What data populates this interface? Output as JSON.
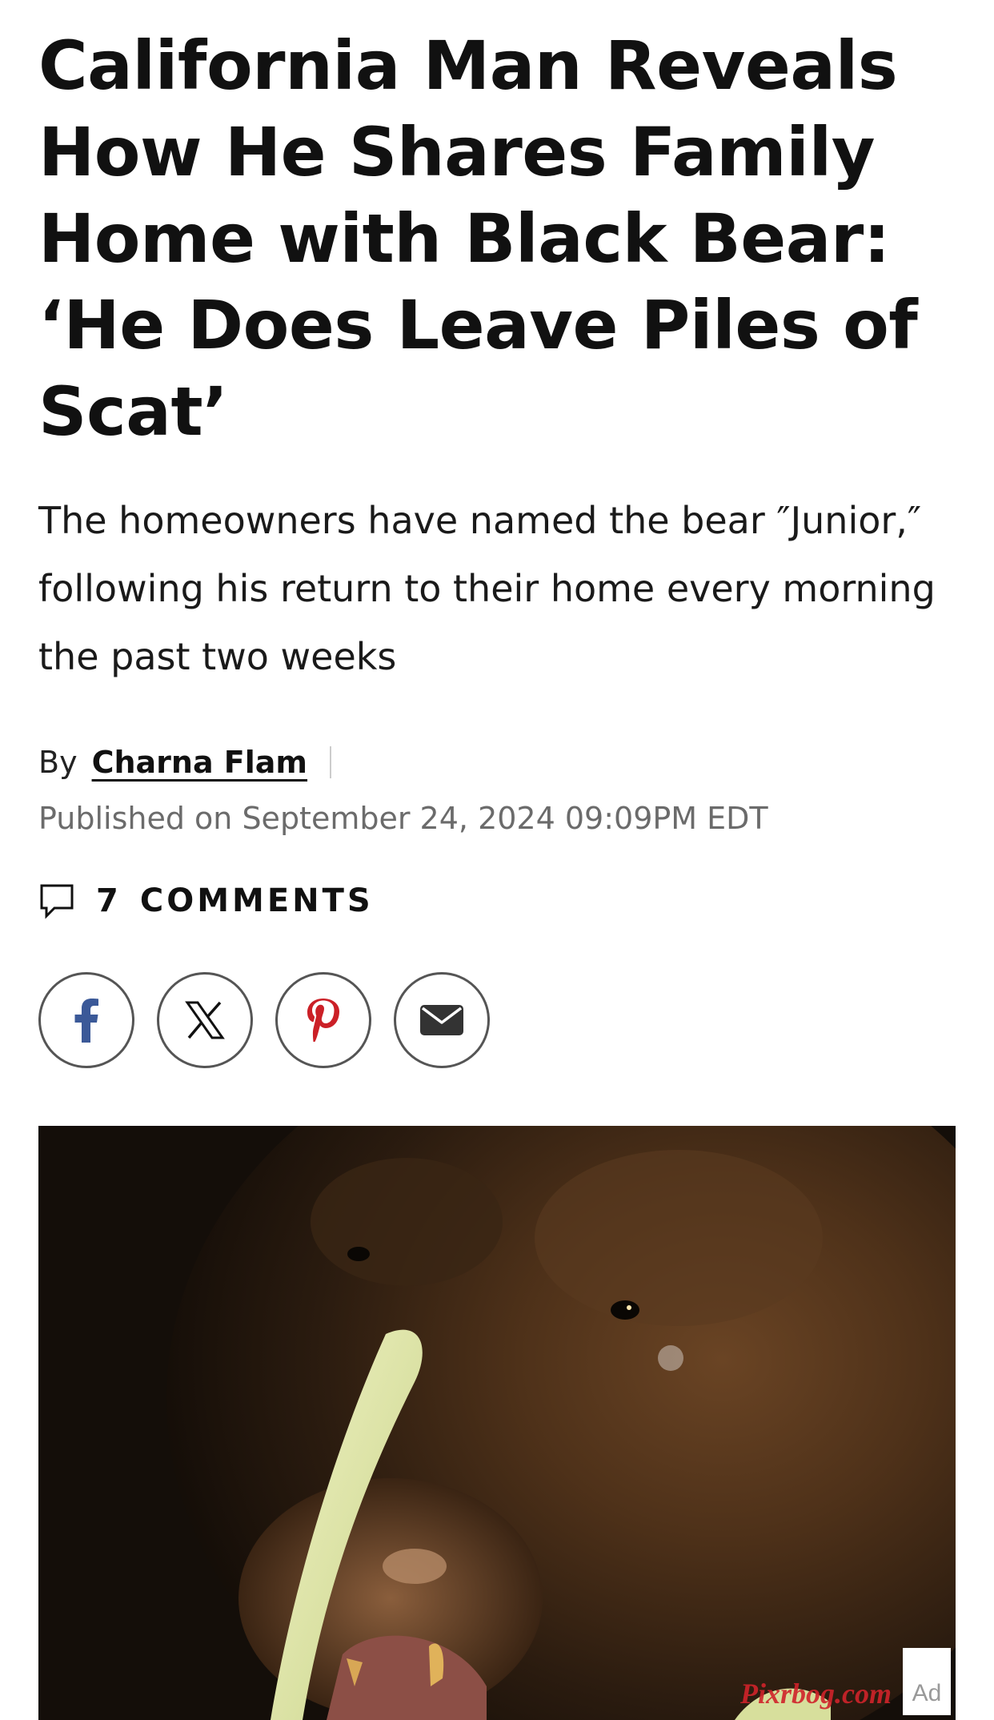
{
  "article": {
    "headline": "California Man Reveals How He Shares Family Home with Black Bear: ‘He Does Leave Piles of Scat’",
    "dek": "The homeowners have named the bear ″Junior,″ following his return to their home every morning the past two weeks",
    "byline_prefix": "By",
    "author": "Charna Flam",
    "published": "Published on September 24, 2024 09:09PM EDT",
    "comments_count": "7",
    "comments_label": "COMMENTS"
  },
  "share_buttons": [
    {
      "name": "facebook",
      "icon": "facebook-icon",
      "color": "#3b5998"
    },
    {
      "name": "x",
      "icon": "x-icon",
      "color": "#111111"
    },
    {
      "name": "pinterest",
      "icon": "pinterest-icon",
      "color": "#cb2027"
    },
    {
      "name": "email",
      "icon": "mail-icon",
      "color": "#333333"
    }
  ],
  "hero_image": {
    "subject": "black bear close-up at night"
  },
  "ad": {
    "label": "Ad"
  },
  "watermark": {
    "text": "Pixrbog.com"
  },
  "colors": {
    "text": "#111111",
    "muted": "#6b6b6b",
    "border": "#555555"
  }
}
